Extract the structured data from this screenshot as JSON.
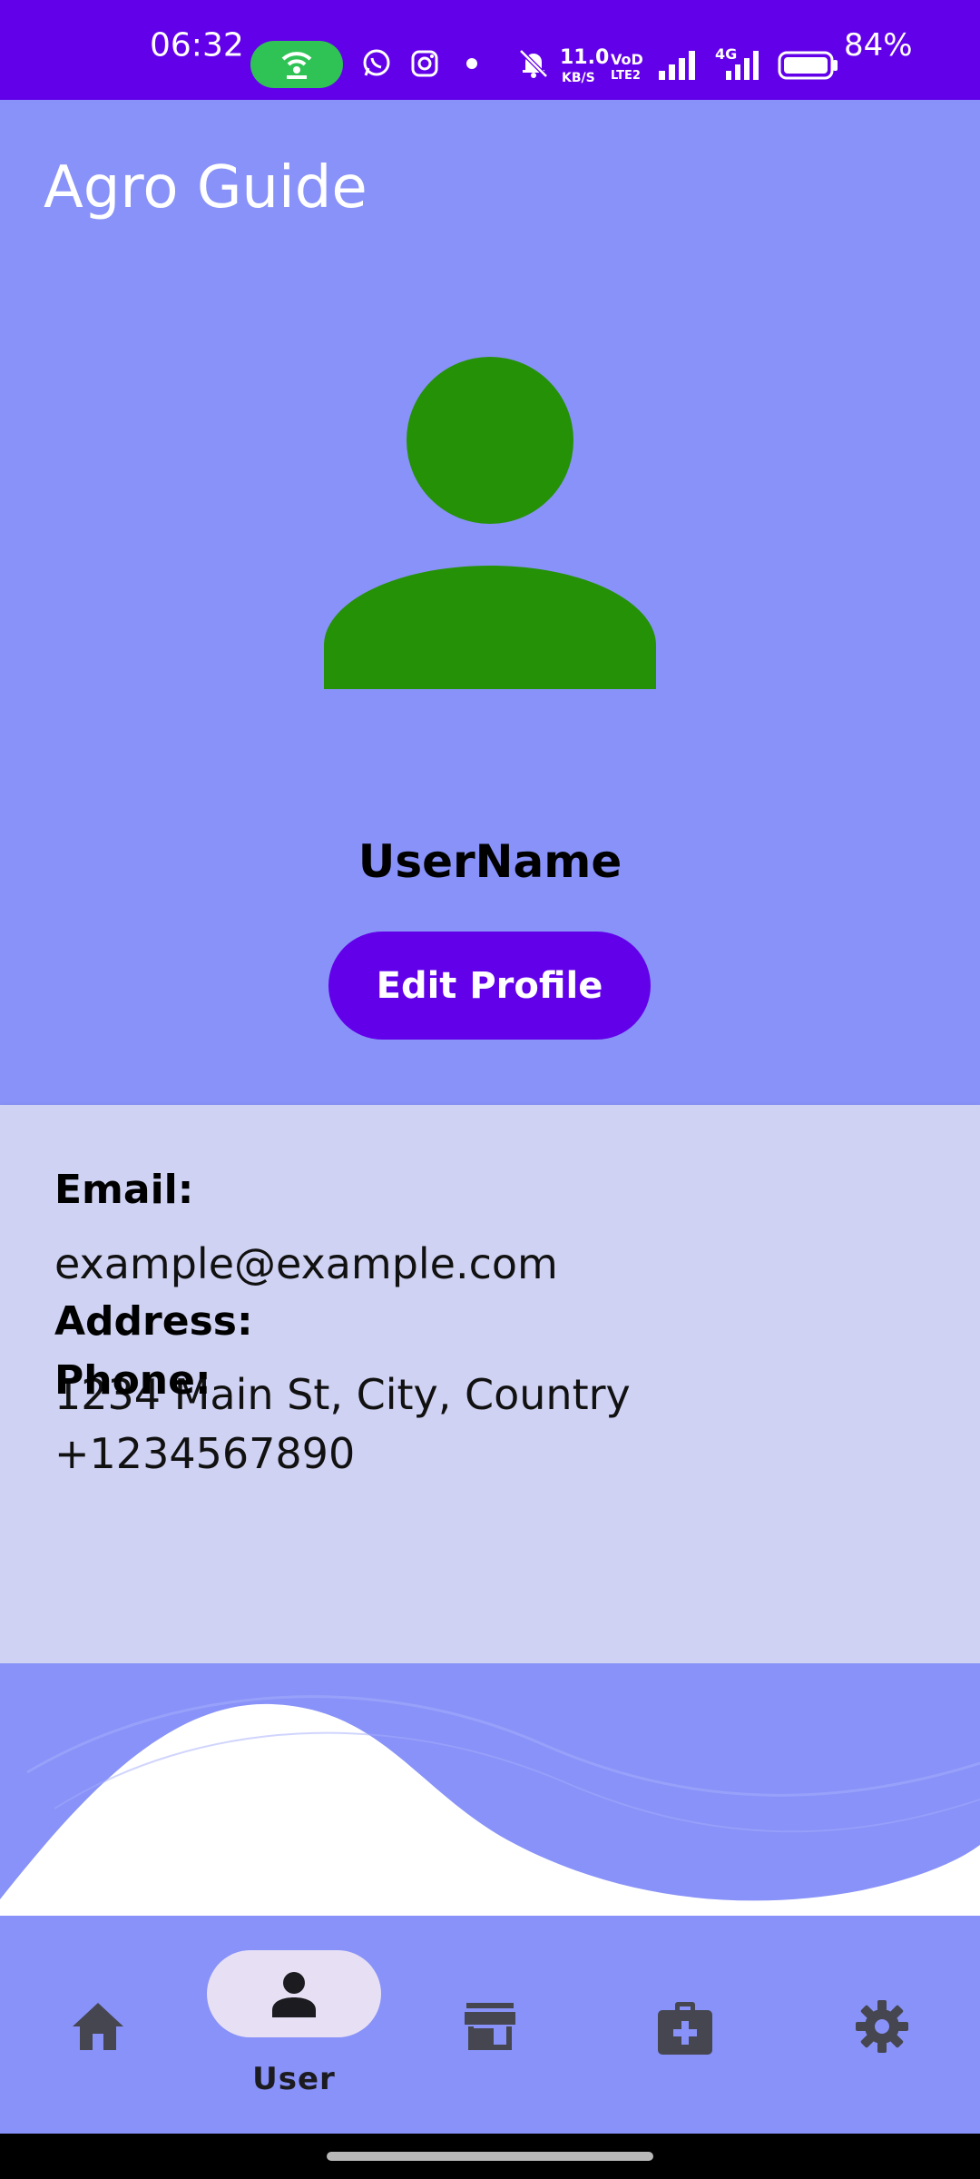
{
  "status_bar": {
    "time": "06:32",
    "net_speed_value": "11.0",
    "net_speed_unit": "KB/S",
    "volte_top": "VoD",
    "volte_bottom": "LTE2",
    "net_type": "4G",
    "battery_percent": "84%",
    "battery_level": 0.84,
    "icons": [
      "hotspot-icon",
      "whatsapp-icon",
      "instagram-icon",
      "dot-icon",
      "bell-off-icon",
      "signal-icon",
      "signal-4g-icon",
      "battery-icon"
    ]
  },
  "app": {
    "title": "Agro Guide"
  },
  "profile": {
    "avatar_icon": "person-icon",
    "avatar_color": "#259107",
    "user_name": "UserName",
    "edit_button_label": "Edit Profile"
  },
  "info": {
    "email_label": "Email:",
    "email_value": "example@example.com",
    "address_label": "Address:",
    "address_value": "1234 Main St, City, Country",
    "phone_label": "Phone:",
    "phone_value": "+1234567890"
  },
  "bottom_nav": {
    "items": [
      {
        "icon": "home-icon",
        "label": ""
      },
      {
        "icon": "person-icon",
        "label": "User",
        "selected": true
      },
      {
        "icon": "store-icon",
        "label": ""
      },
      {
        "icon": "medical-kit-icon",
        "label": ""
      },
      {
        "icon": "gear-icon",
        "label": ""
      }
    ],
    "active_label": "User"
  },
  "colors": {
    "primary": "#6200ea",
    "background": "#8892f8",
    "card": "#cfd2f2",
    "nav_active_pill": "#e7e0f5"
  }
}
